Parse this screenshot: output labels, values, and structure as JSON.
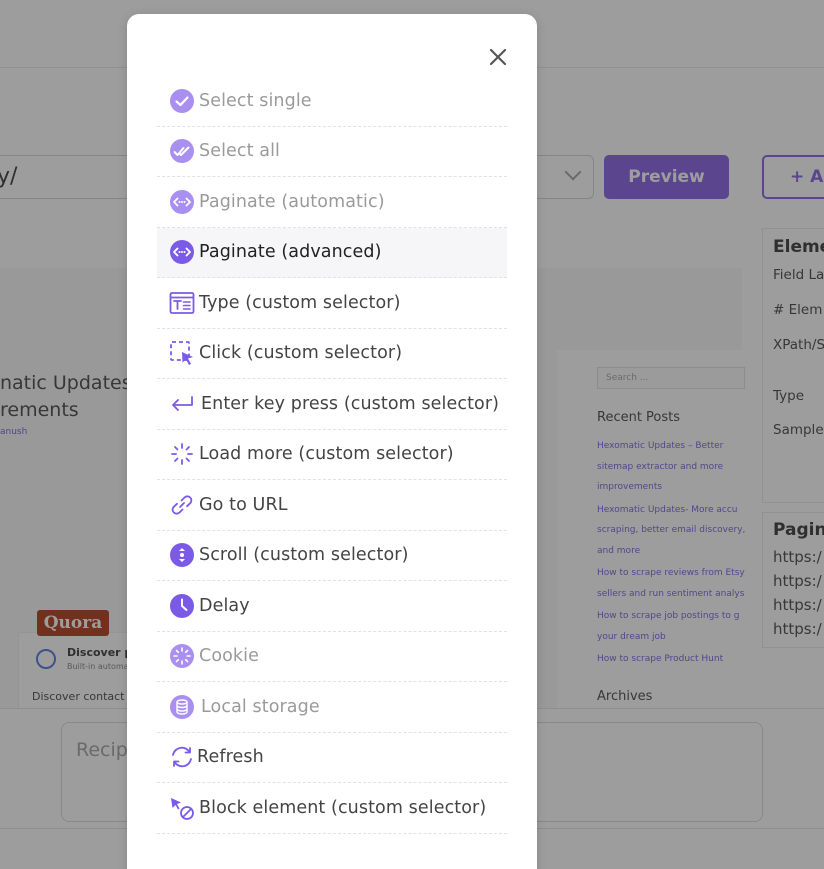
{
  "background": {
    "url_text": "y/",
    "preview_label": "Preview",
    "add_label": "+ Ad",
    "article_title": "natic Updates -\nrements",
    "article_author": "anush",
    "quora_logo_text": "Quora",
    "card_title": "Discover p",
    "card_subtitle": "Built-in automa",
    "card_text": "Discover contact",
    "search_placeholder": "Search ...",
    "recent_posts_heading": "Recent Posts",
    "recent_posts": [
      "Hexomatic Updates – Better\nsitemap extractor and more\nimprovements",
      "Hexomatic Updates- More accu\nscraping, better email discovery,\nand more",
      "How to scrape reviews from Etsy\nsellers and run sentiment analys",
      "How to scrape job postings to g\nyour dream job",
      "How to scrape Product Hunt"
    ],
    "archives_heading": "Archives",
    "right_panel": {
      "title": "Eleme",
      "field_label": "Field La",
      "elements": "# Elem",
      "xpath": "XPath/S",
      "type": "Type",
      "sample": "Sample",
      "pagination_title": "Pagin",
      "links": [
        "https:/",
        "https:/",
        "https:/",
        "https:/"
      ]
    },
    "recipe_placeholder": "Recipe"
  },
  "modal": {
    "close_icon": "close-icon",
    "accent_color": "#7b5be6",
    "disabled_color": "#a98ff0",
    "items": [
      {
        "label": "Select single",
        "icon": "check-circle-icon",
        "state": "disabled"
      },
      {
        "label": "Select all",
        "icon": "double-check-circle-icon",
        "state": "disabled"
      },
      {
        "label": "Paginate (automatic)",
        "icon": "paginate-icon",
        "state": "disabled"
      },
      {
        "label": "Paginate (advanced)",
        "icon": "paginate-icon",
        "state": "active"
      },
      {
        "label": "Type (custom selector)",
        "icon": "type-icon",
        "state": "normal"
      },
      {
        "label": "Click (custom selector)",
        "icon": "click-icon",
        "state": "normal"
      },
      {
        "label": "Enter key press (custom selector)",
        "icon": "enter-key-icon",
        "state": "normal"
      },
      {
        "label": "Load more (custom selector)",
        "icon": "load-more-icon",
        "state": "normal"
      },
      {
        "label": "Go to URL",
        "icon": "link-icon",
        "state": "normal"
      },
      {
        "label": "Scroll (custom selector)",
        "icon": "scroll-icon",
        "state": "normal"
      },
      {
        "label": "Delay",
        "icon": "clock-icon",
        "state": "normal"
      },
      {
        "label": "Cookie",
        "icon": "cookie-icon",
        "state": "disabled"
      },
      {
        "label": "Local storage",
        "icon": "database-icon",
        "state": "disabled"
      },
      {
        "label": "Refresh",
        "icon": "refresh-icon",
        "state": "normal"
      },
      {
        "label": "Block element (custom selector)",
        "icon": "block-element-icon",
        "state": "normal"
      }
    ]
  }
}
